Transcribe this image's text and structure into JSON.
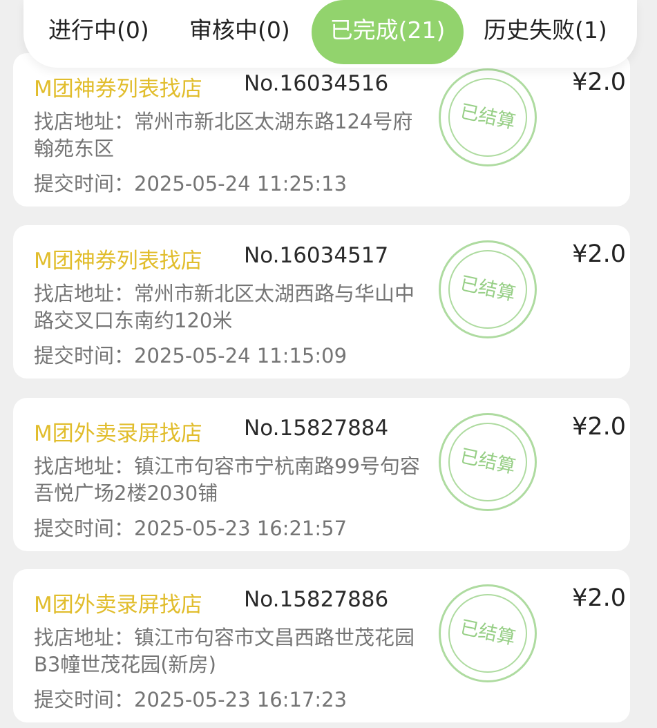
{
  "tabs": [
    {
      "label": "进行中(0)"
    },
    {
      "label": "审核中(0)"
    },
    {
      "label": "已完成(21)",
      "active": true
    },
    {
      "label": "历史失败(1)"
    }
  ],
  "accent_color": "#92d36d",
  "title_color": "#e1bd2c",
  "orders": [
    {
      "title": "M团神券列表找店",
      "number": "No.16034516",
      "address_label": "找店地址：",
      "address": "常州市新北区太湖东路124号府翰苑东区",
      "time_label": "提交时间：",
      "time": "2025-05-24 11:25:13",
      "status": "已结算",
      "price": "¥2.0"
    },
    {
      "title": "M团神券列表找店",
      "number": "No.16034517",
      "address_label": "找店地址：",
      "address": "常州市新北区太湖西路与华山中路交叉口东南约120米",
      "time_label": "提交时间：",
      "time": "2025-05-24 11:15:09",
      "status": "已结算",
      "price": "¥2.0"
    },
    {
      "title": "M团外卖录屏找店",
      "number": "No.15827884",
      "address_label": "找店地址：",
      "address": "镇江市句容市宁杭南路99号句容吾悦广场2楼2030铺",
      "time_label": "提交时间：",
      "time": "2025-05-23 16:21:57",
      "status": "已结算",
      "price": "¥2.0"
    },
    {
      "title": "M团外卖录屏找店",
      "number": "No.15827886",
      "address_label": "找店地址：",
      "address": "镇江市句容市文昌西路世茂花园B3幢世茂花园(新房)",
      "time_label": "提交时间：",
      "time": "2025-05-23 16:17:23",
      "status": "已结算",
      "price": "¥2.0"
    }
  ]
}
